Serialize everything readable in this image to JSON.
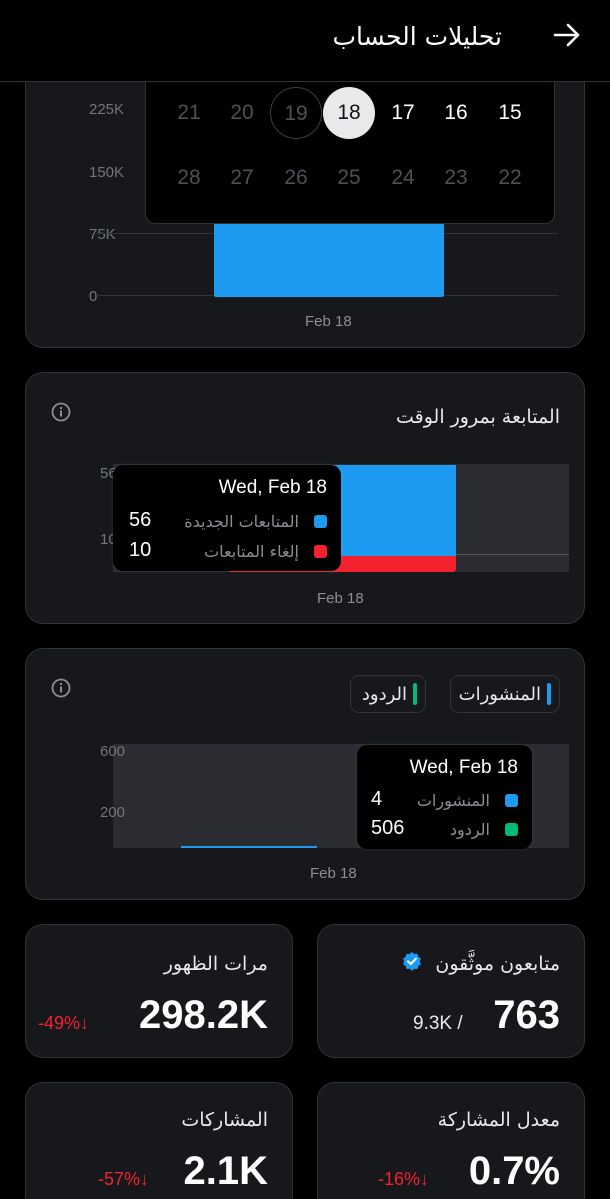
{
  "header": {
    "title": "تحليلات الحساب",
    "back_icon": "arrow-right-icon"
  },
  "calendar": {
    "rows": [
      [
        {
          "day": "21",
          "state": "muted"
        },
        {
          "day": "20",
          "state": "muted"
        },
        {
          "day": "19",
          "state": "outlined"
        },
        {
          "day": "18",
          "state": "selected"
        },
        {
          "day": "17",
          "state": "active"
        },
        {
          "day": "16",
          "state": "active"
        },
        {
          "day": "15",
          "state": "active"
        }
      ],
      [
        {
          "day": "28",
          "state": "muted"
        },
        {
          "day": "27",
          "state": "muted"
        },
        {
          "day": "26",
          "state": "muted"
        },
        {
          "day": "25",
          "state": "muted"
        },
        {
          "day": "24",
          "state": "muted"
        },
        {
          "day": "23",
          "state": "muted"
        },
        {
          "day": "22",
          "state": "muted"
        }
      ]
    ]
  },
  "impressions_chart": {
    "y_ticks": [
      "225K",
      "150K",
      "75K",
      "0"
    ],
    "x_label": "Feb 18",
    "bar_color": "#1d9bf0"
  },
  "follows_chart": {
    "title": "المتابعة بمرور الوقت",
    "y_ticks": [
      "56",
      "10"
    ],
    "x_label": "Feb 18",
    "tooltip": {
      "date": "Wed, Feb 18",
      "rows": [
        {
          "label": "المتابعات الجديدة",
          "value": "56",
          "color": "#1d9bf0"
        },
        {
          "label": "إلغاء المتابعات",
          "value": "10",
          "color": "#f4212e"
        }
      ]
    }
  },
  "posts_chart": {
    "legend": [
      {
        "label": "المنشورات",
        "color": "#1d9bf0"
      },
      {
        "label": "الردود",
        "color": "#00ba7c"
      }
    ],
    "y_ticks": [
      "600",
      "200"
    ],
    "x_label": "Feb 18",
    "tooltip": {
      "date": "Wed, Feb 18",
      "rows": [
        {
          "label": "المنشورات",
          "value": "4",
          "color": "#1d9bf0"
        },
        {
          "label": "الردود",
          "value": "506",
          "color": "#00ba7c"
        }
      ]
    }
  },
  "stats": {
    "verified_followers": {
      "title": "متابعون موثَّقون",
      "value": "763",
      "sub": "9.3K /"
    },
    "impressions": {
      "title": "مرات الظهور",
      "value": "298.2K",
      "change": "-49%↓"
    },
    "engagement_rate": {
      "title": "معدل المشاركة",
      "value": "0.7%",
      "change": "-16%↓"
    },
    "engagements": {
      "title": "المشاركات",
      "value": "2.1K",
      "change": "-57%↓"
    }
  },
  "chart_data": [
    {
      "type": "bar",
      "categories": [
        "Feb 18"
      ],
      "values": [
        300000
      ],
      "title": "",
      "xlabel": "",
      "ylabel": "",
      "y_ticks": [
        "0",
        "75K",
        "150K",
        "225K"
      ],
      "grid": true
    },
    {
      "type": "bar",
      "title": "المتابعة بمرور الوقت",
      "categories": [
        "Feb 18"
      ],
      "series": [
        {
          "name": "المتابعات الجديدة",
          "values": [
            56
          ]
        },
        {
          "name": "إلغاء المتابعات",
          "values": [
            10
          ]
        }
      ],
      "y_ticks": [
        "10",
        "56"
      ]
    },
    {
      "type": "bar",
      "categories": [
        "Feb 18"
      ],
      "series": [
        {
          "name": "المنشورات",
          "values": [
            4
          ]
        },
        {
          "name": "الردود",
          "values": [
            506
          ]
        }
      ],
      "y_ticks": [
        "200",
        "600"
      ]
    }
  ]
}
